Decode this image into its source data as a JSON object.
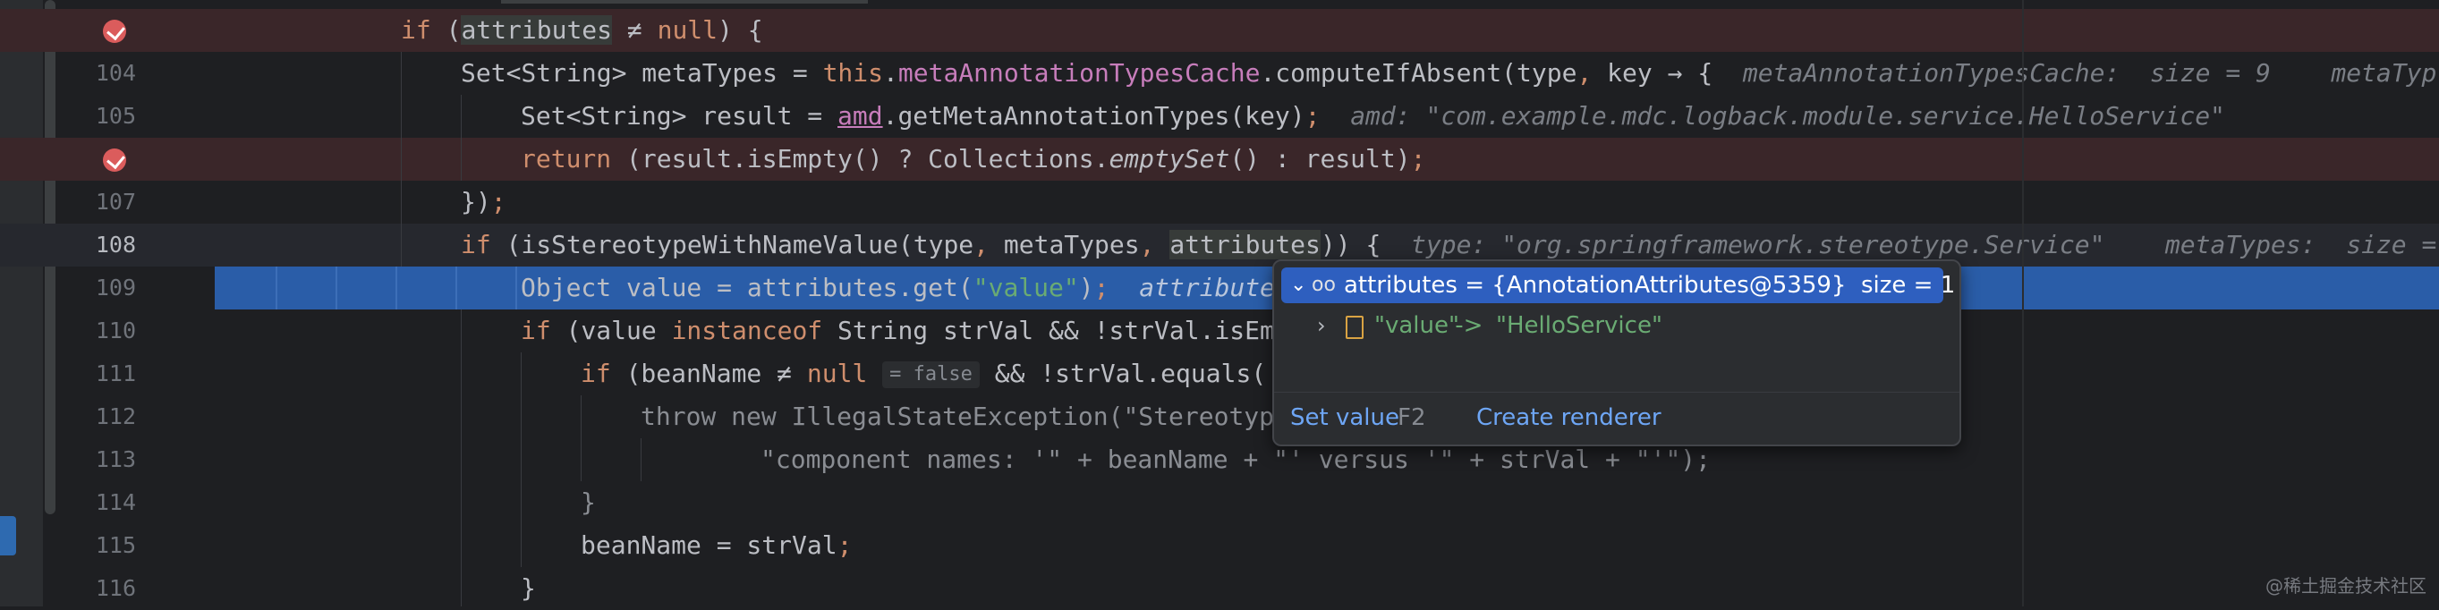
{
  "editor": {
    "lines": [
      {
        "number": "",
        "breakpoint": true,
        "highlight": "bp",
        "segments": [
          "if",
          " (",
          "attributes",
          " ≠ ",
          "null",
          ") {"
        ]
      },
      {
        "number": "104",
        "segments": [
          "Set<String> metaTypes = ",
          "this",
          ".",
          "metaAnnotationTypesCache",
          ".computeIfAbsent(type",
          ",",
          " key → {"
        ],
        "hint": "metaAnnotationTypesCache:  size = 9    metaTyp"
      },
      {
        "number": "105",
        "segments": [
          "Set<String> result = ",
          "amd",
          ".getMetaAnnotationTypes(key)",
          ";"
        ],
        "hint": "amd: \"com.example.mdc.logback.module.service.HelloService\""
      },
      {
        "number": "",
        "breakpoint": true,
        "segments": [
          "return",
          " (result.isEmpty() ? Collections.",
          "emptySet",
          "() : result)",
          ";"
        ]
      },
      {
        "number": "107",
        "segments": [
          "})",
          ";"
        ]
      },
      {
        "number": "108",
        "segments": [
          "if",
          " (isStereotypeWithNameValue(type",
          ",",
          " metaTypes",
          ",",
          " ",
          "attributes",
          ")) {"
        ],
        "hint": "type: \"org.springframework.stereotype.Service\"    metaTypes:  size = "
      },
      {
        "number": "109",
        "segments": [
          "Object value = attributes.get(",
          "\"value\"",
          ")",
          ";"
        ],
        "hint": "attribute"
      },
      {
        "number": "110",
        "segments": [
          "if",
          " (value ",
          "instanceof",
          " String strVal && !strVal.isEm"
        ]
      },
      {
        "number": "111",
        "segments": [
          "if",
          " (beanName ≠ ",
          "null",
          "= false",
          " && !strVal.equals("
        ]
      },
      {
        "number": "112",
        "segments": [
          "throw new IllegalStateException(\"Stereotyp"
        ]
      },
      {
        "number": "113",
        "segments": [
          "\"component names: '\" + beanName + \"' versus '\" + strVal + \"'\");"
        ]
      },
      {
        "number": "114",
        "segments": [
          "}"
        ]
      },
      {
        "number": "115",
        "segments": [
          "beanName = strVal",
          ";"
        ]
      },
      {
        "number": "116",
        "segments": [
          "}"
        ]
      }
    ]
  },
  "popup": {
    "root": "attributes = {AnnotationAttributes@5359}  size = 1",
    "child_key": "\"value\"",
    "child_arrow": " -> ",
    "child_value": "\"HelloService\"",
    "set_value": "Set value",
    "set_value_key": "F2",
    "create_renderer": "Create renderer"
  },
  "watermark": "@稀土掘金技术社区",
  "colors": {
    "keyword": "#cf8e6d",
    "field": "#c77dbb",
    "string": "#6aab73",
    "execution_line": "#2a5da8",
    "breakpoint": "#db5c5c",
    "link": "#6ea6f5"
  }
}
